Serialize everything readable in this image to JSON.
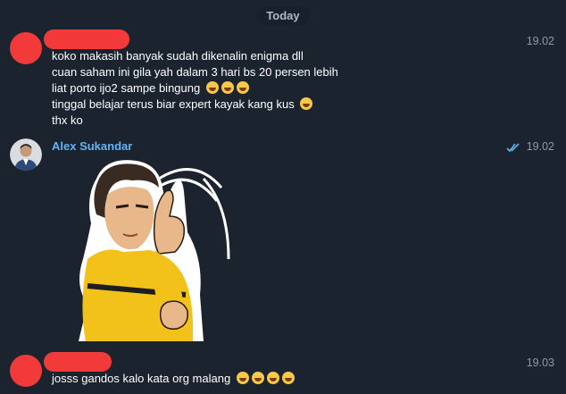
{
  "day_header": "Today",
  "messages": [
    {
      "time": "19.02",
      "lines": [
        "koko makasih banyak sudah dikenalin enigma dll",
        "cuan saham ini gila yah dalam 3 hari bs 20 persen lebih",
        "liat porto ijo2 sampe bingung",
        "tinggal belajar terus biar expert kayak kang kus",
        "thx ko"
      ]
    },
    {
      "sender": "Alex Sukandar",
      "time": "19.02",
      "status_icon": "double-check-icon",
      "sticker": "kung-fu-fighter-thumbs-up-sticker"
    },
    {
      "time": "19.03",
      "lines": [
        "josss gandos kalo kata org malang"
      ]
    }
  ],
  "colors": {
    "background": "#1b232f",
    "sender_name": "#5eb5f7",
    "redaction": "#f23a3a",
    "timestamp": "#8e99a7"
  }
}
